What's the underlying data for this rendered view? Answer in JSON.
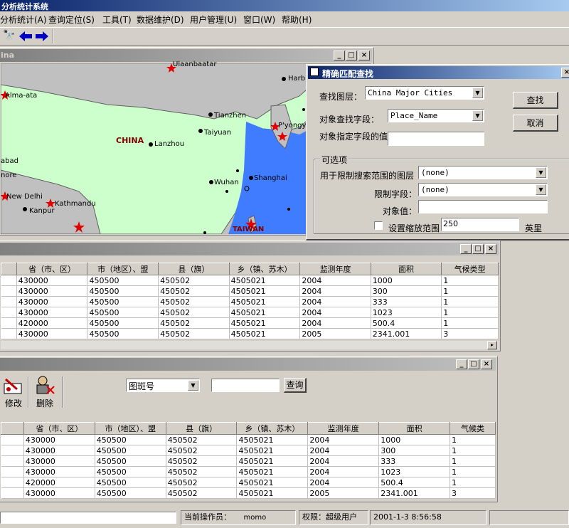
{
  "app_title": "分析统计系统",
  "menu": [
    "分析统计(A)",
    "查询定位(S)",
    "工具(T)",
    "数据维护(D)",
    "用户管理(U)",
    "窗口(W)",
    "帮助(H)"
  ],
  "map_window": {
    "title": "ina",
    "country_labels": [
      "CHINA",
      "TAIWAN"
    ],
    "cities": [
      "Harbin",
      "Alma-ata",
      "Tianzhen",
      "P'yongya",
      "Taiyuan",
      "Lanzhou",
      "Shanghai",
      "Wuhan",
      "New Delhi",
      "Kathmandu",
      "Kanpur",
      "nore",
      "abad",
      "Ulaanbaatar"
    ]
  },
  "dialog": {
    "title": "精确匹配查找",
    "layer_label": "查找图层：",
    "layer_value": "China Major Cities",
    "field_label": "对象查找字段：",
    "field_value": "Place_Name",
    "value_label": "对象指定字段的值",
    "value_text": "",
    "find_button": "查找",
    "cancel_button": "取消",
    "optional_group": "可选项",
    "limit_layer_label": "用于限制搜索范围的图层",
    "limit_layer_value": "(none)",
    "limit_field_label": "限制字段：",
    "limit_field_value": "(none)",
    "object_value_label": "对象值：",
    "object_value": "",
    "zoom_label": "设置缩放范围",
    "zoom_value": "250",
    "zoom_unit": "英里"
  },
  "grid1": {
    "headers": [
      "省（市、区）",
      "市（地区）、盟",
      "县（旗）",
      "乡（镇、苏木）",
      "监测年度",
      "面积",
      "气候类型"
    ],
    "rows": [
      [
        "430000",
        "450500",
        "450502",
        "4505021",
        "2004",
        "1000",
        "1"
      ],
      [
        "430000",
        "450500",
        "450502",
        "4505021",
        "2004",
        "300",
        "1"
      ],
      [
        "430000",
        "450500",
        "450502",
        "4505021",
        "2004",
        "333",
        "1"
      ],
      [
        "430000",
        "450500",
        "450502",
        "4505021",
        "2004",
        "1023",
        "1"
      ],
      [
        "420000",
        "450500",
        "450502",
        "4505021",
        "2004",
        "500.4",
        "1"
      ],
      [
        "430000",
        "450500",
        "450502",
        "4505021",
        "2005",
        "2341.001",
        "3"
      ]
    ]
  },
  "query_window": {
    "modify_label": "修改",
    "delete_label": "删除",
    "field_select": "图斑号",
    "query_input": "",
    "query_button": "查询",
    "headers": [
      "省（市、区）",
      "市（地区）、盟",
      "县（旗）",
      "乡（镇、苏木）",
      "监测年度",
      "面积",
      "气候类"
    ],
    "rows": [
      [
        "430000",
        "450500",
        "450502",
        "4505021",
        "2004",
        "1000",
        "1"
      ],
      [
        "430000",
        "450500",
        "450502",
        "4505021",
        "2004",
        "300",
        "1"
      ],
      [
        "430000",
        "450500",
        "450502",
        "4505021",
        "2004",
        "333",
        "1"
      ],
      [
        "430000",
        "450500",
        "450502",
        "4505021",
        "2004",
        "1023",
        "1"
      ],
      [
        "420000",
        "450500",
        "450502",
        "4505021",
        "2004",
        "500.4",
        "1"
      ],
      [
        "430000",
        "450500",
        "450502",
        "4505021",
        "2005",
        "2341.001",
        "3"
      ]
    ]
  },
  "status": {
    "operator_label": "当前操作员：",
    "operator_value": "momo",
    "permission": "权限：超级用户",
    "datetime": "2001-1-3 8:56:58"
  },
  "colors": {
    "sea": "#3f7cff",
    "land": "#ccffcc",
    "neighbor": "#c0c0c0",
    "title_active": "#0a246a"
  }
}
